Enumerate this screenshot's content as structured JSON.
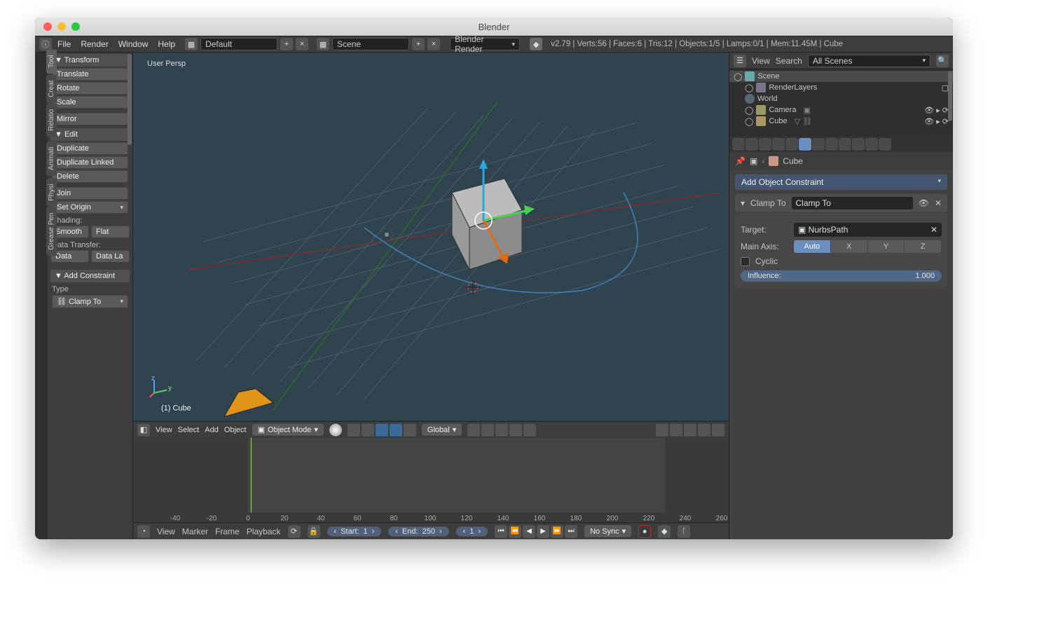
{
  "title": "Blender",
  "topbar": {
    "menus": [
      "File",
      "Render",
      "Window",
      "Help"
    ],
    "layout_label": "Default",
    "scene_label": "Scene",
    "engine": "Blender Render",
    "status": "v2.79 | Verts:56 | Faces:6 | Tris:12 | Objects:1/5 | Lamps:0/1 | Mem:11.45M | Cube"
  },
  "toolshelf": {
    "tabs": [
      "Tool",
      "Creat",
      "Relatio",
      "Animati",
      "Physi",
      "Grease Pen"
    ],
    "transform_header": "Transform",
    "transform": [
      "Translate",
      "Rotate",
      "Scale",
      "Mirror"
    ],
    "edit_header": "Edit",
    "edit": [
      "Duplicate",
      "Duplicate Linked",
      "Delete",
      "Join"
    ],
    "set_origin": "Set Origin",
    "shading_label": "Shading:",
    "shading": [
      "Smooth",
      "Flat"
    ],
    "data_transfer_label": "Data Transfer:",
    "data_transfer": [
      "Data",
      "Data La"
    ],
    "add_constraint_header": "Add Constraint",
    "type_label": "Type",
    "constraint_type": "Clamp To"
  },
  "viewport": {
    "persp": "User Persp",
    "selected": "(1) Cube",
    "menus": [
      "View",
      "Select",
      "Add",
      "Object"
    ],
    "mode": "Object Mode",
    "orientation": "Global",
    "axis_z": "z",
    "axis_y": "y"
  },
  "timeline": {
    "ticks": [
      "-40",
      "-20",
      "0",
      "20",
      "40",
      "60",
      "80",
      "100",
      "120",
      "140",
      "160",
      "180",
      "200",
      "220",
      "240",
      "260"
    ],
    "menus": [
      "View",
      "Marker",
      "Frame",
      "Playback"
    ],
    "start_label": "Start:",
    "start_value": "1",
    "end_label": "End:",
    "end_value": "250",
    "current": "1",
    "sync": "No Sync"
  },
  "outliner": {
    "menus": [
      "View",
      "Search"
    ],
    "filter": "All Scenes",
    "items": [
      {
        "label": "Scene",
        "depth": 0,
        "sel": true
      },
      {
        "label": "RenderLayers",
        "depth": 1
      },
      {
        "label": "World",
        "depth": 1
      },
      {
        "label": "Camera",
        "depth": 1
      },
      {
        "label": "Cube",
        "depth": 1
      }
    ]
  },
  "properties": {
    "object_name": "Cube",
    "add_constraint": "Add Object Constraint",
    "constraint": {
      "type": "Clamp To",
      "name": "Clamp To",
      "target_label": "Target:",
      "target": "NurbsPath",
      "axis_label": "Main Axis:",
      "axes": [
        "Auto",
        "X",
        "Y",
        "Z"
      ],
      "cyclic_label": "Cyclic",
      "influence_label": "Influence:",
      "influence_value": "1.000"
    }
  }
}
